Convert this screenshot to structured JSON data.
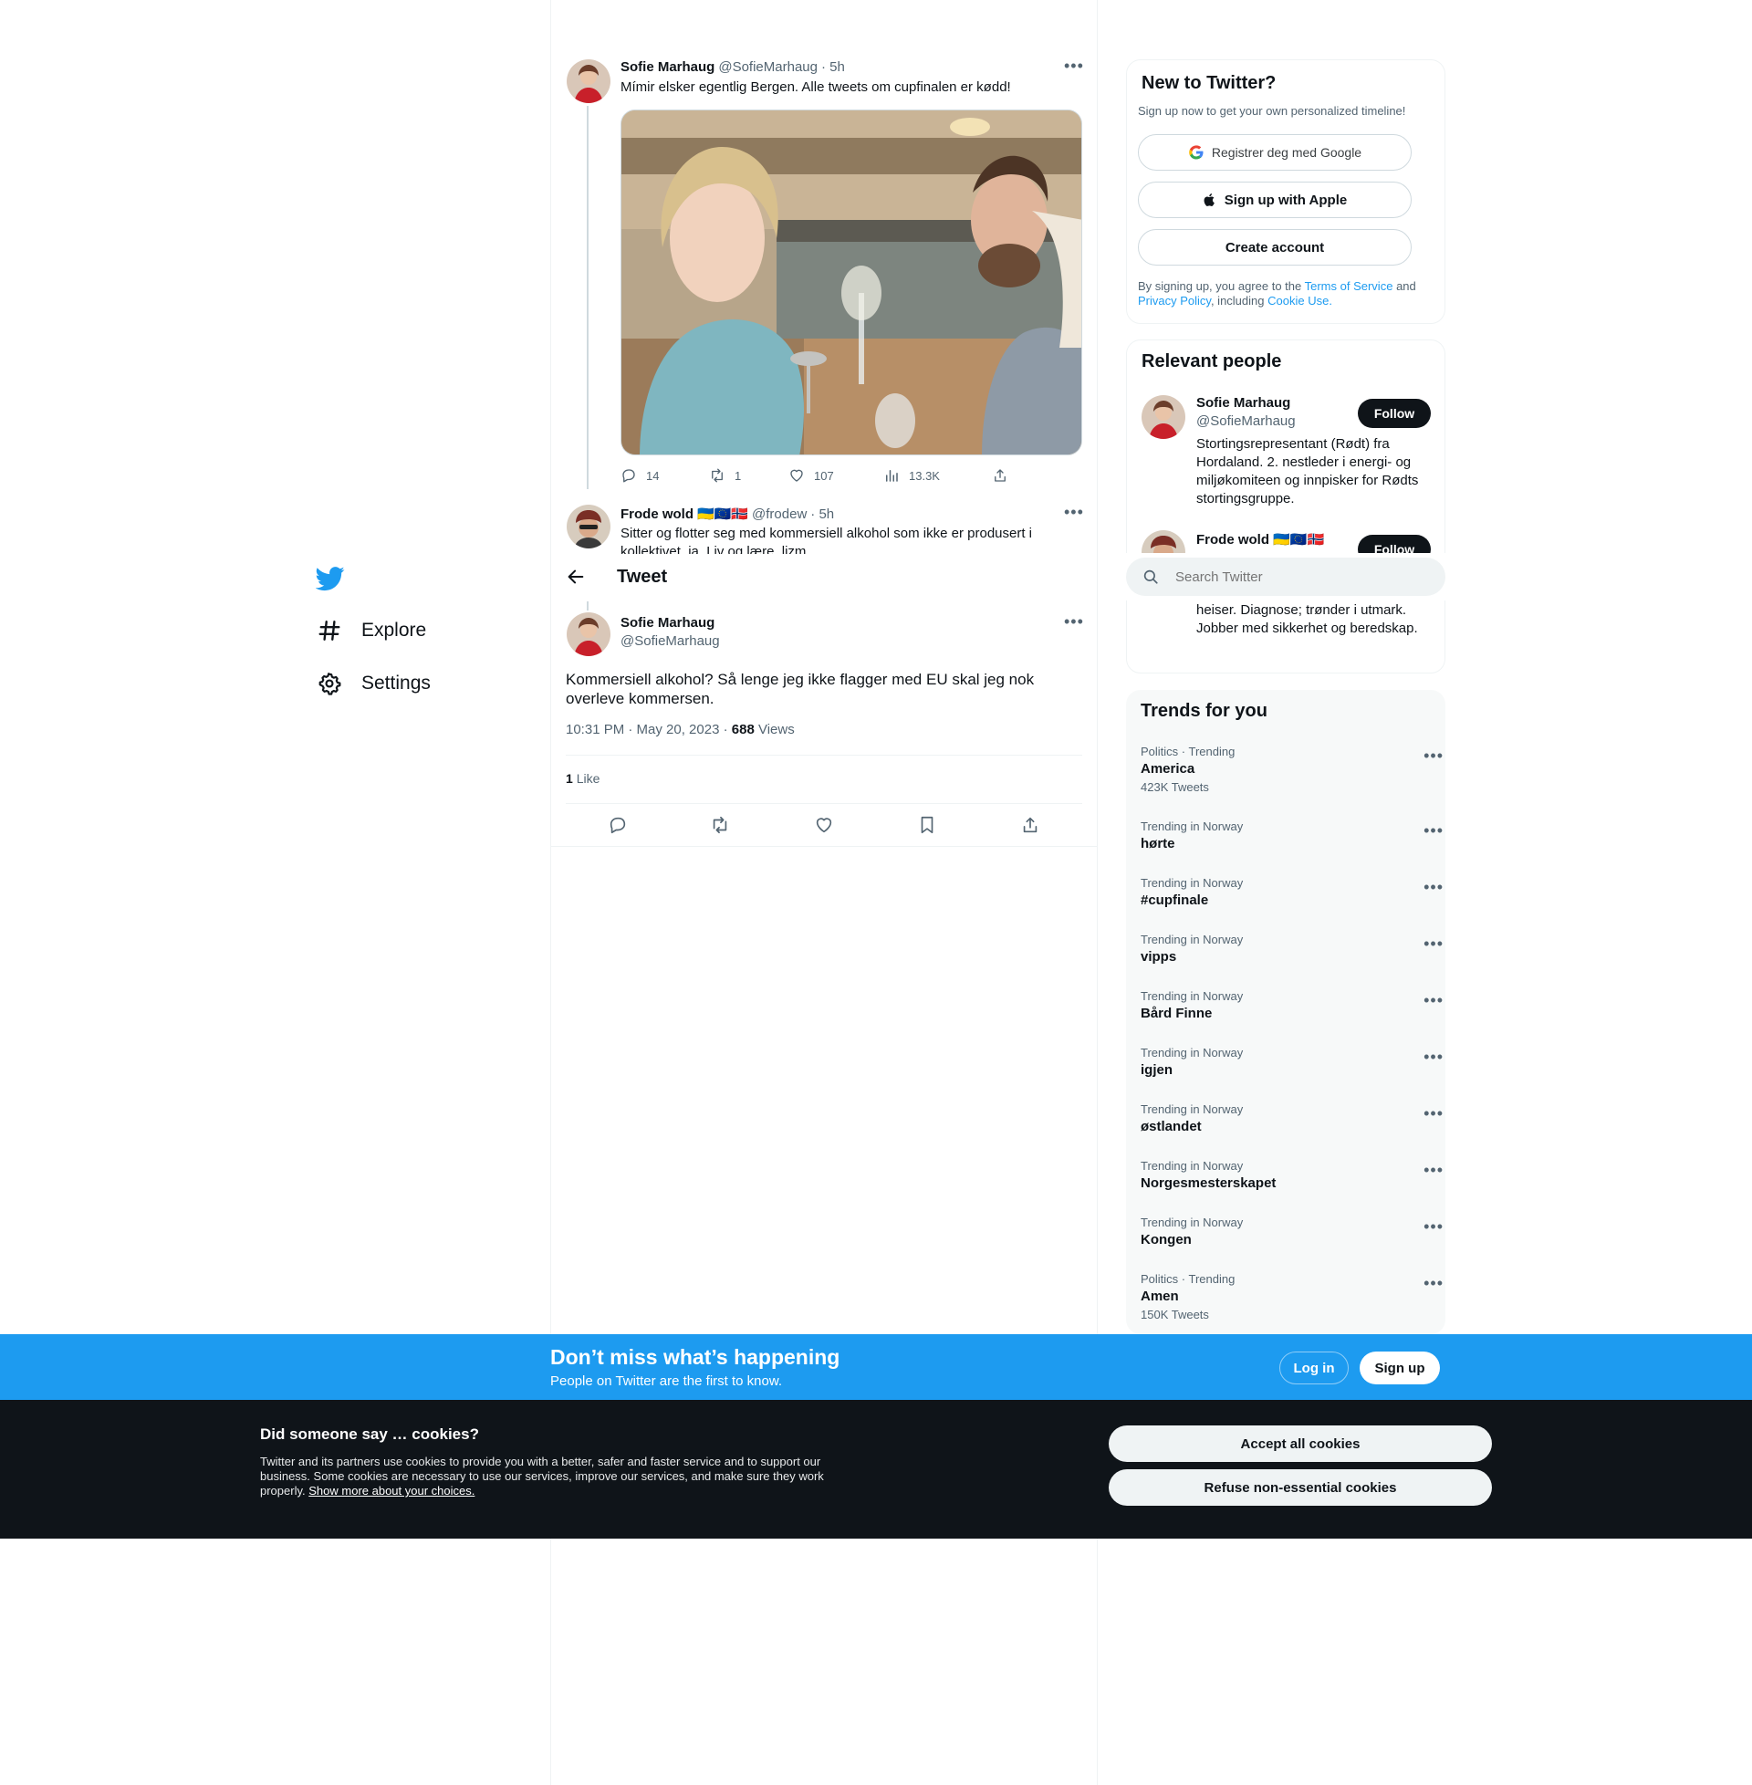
{
  "nav": {
    "explore": "Explore",
    "settings": "Settings"
  },
  "header": {
    "title": "Tweet"
  },
  "search": {
    "placeholder": "Search Twitter"
  },
  "tweet1": {
    "name": "Sofie Marhaug",
    "handle": "@SofieMarhaug",
    "time": "· 5h",
    "text": "Mímir elsker egentlig Bergen. Alle tweets om cupfinalen er kødd!",
    "replies": "14",
    "retweets": "1",
    "likes": "107",
    "views": "13.3K"
  },
  "tweet2": {
    "name": "Frode wold",
    "flags": "🇺🇦🇪🇺🇳🇴",
    "handle": "@frodew",
    "time": "· 5h",
    "text": "Sitter og flotter seg med kommersiell alkohol som ikke er produsert i kollektivet, ja. Liv og lære, lizm"
  },
  "main_tweet": {
    "name": "Sofie Marhaug",
    "handle": "@SofieMarhaug",
    "text": "Kommersiell alkohol? Så lenge jeg ikke flagger med EU skal jeg nok overleve kommersen.",
    "timestamp": "10:31 PM · May 20, 2023 ·",
    "views_count": "688",
    "views_label": "Views",
    "likes_count": "1",
    "likes_label": "Like"
  },
  "new_to_twitter": {
    "title": "New to Twitter?",
    "subtitle": "Sign up now to get your own personalized timeline!",
    "google": "Registrer deg med Google",
    "apple": "Sign up with Apple",
    "create": "Create account",
    "legal_1": "By signing up, you agree to the",
    "terms": "Terms of Service",
    "legal_2": "and",
    "privacy": "Privacy Policy",
    "legal_3": ", including",
    "cookie_use": "Cookie Use."
  },
  "relevant_people": {
    "title": "Relevant people",
    "people": [
      {
        "name": "Sofie Marhaug",
        "handle": "@SofieMarhaug",
        "bio": "Stortingsrepresentant (Rødt) fra Hordaland. 2. nestleder i energi- og miljøkomiteen og innpisker for Rødts stortingsgruppe.",
        "follow": "Follow"
      },
      {
        "name": "Frode wold 🇺🇦🇪🇺🇳🇴",
        "bio_visible": "Rødt i naturen. Positivt ingot for store heiser. Diagnose; trønder i utmark. Jobber med sikkerhet og beredskap.",
        "follow": "Follow"
      }
    ]
  },
  "trends": {
    "title": "Trends for you",
    "items": [
      {
        "category": "Politics · Trending",
        "name": "America",
        "count": "423K Tweets"
      },
      {
        "category": "Trending in Norway",
        "name": "hørte",
        "count": ""
      },
      {
        "category": "Trending in Norway",
        "name": "#cupfinale",
        "count": ""
      },
      {
        "category": "Trending in Norway",
        "name": "vipps",
        "count": ""
      },
      {
        "category": "Trending in Norway",
        "name": "Bård Finne",
        "count": ""
      },
      {
        "category": "Trending in Norway",
        "name": "igjen",
        "count": ""
      },
      {
        "category": "Trending in Norway",
        "name": "østlandet",
        "count": ""
      },
      {
        "category": "Trending in Norway",
        "name": "Norgesmesterskapet",
        "count": ""
      },
      {
        "category": "Trending in Norway",
        "name": "Kongen",
        "count": ""
      },
      {
        "category": "Politics · Trending",
        "name": "Amen",
        "count": "150K Tweets"
      }
    ]
  },
  "signup_bar": {
    "title": "Don’t miss what’s happening",
    "subtitle": "People on Twitter are the first to know.",
    "login": "Log in",
    "signup": "Sign up"
  },
  "cookies": {
    "title": "Did someone say … cookies?",
    "body": "Twitter and its partners use cookies to provide you with a better, safer and faster service and to support our business. Some cookies are necessary to use our services, improve our services, and make sure they work properly.",
    "more": "Show more about your choices.",
    "accept": "Accept all cookies",
    "refuse": "Refuse non-essential cookies"
  },
  "colors": {
    "accent": "#1d9bf0",
    "text": "#0f1419",
    "muted": "#536471",
    "cookie_bg": "#0f1419"
  }
}
